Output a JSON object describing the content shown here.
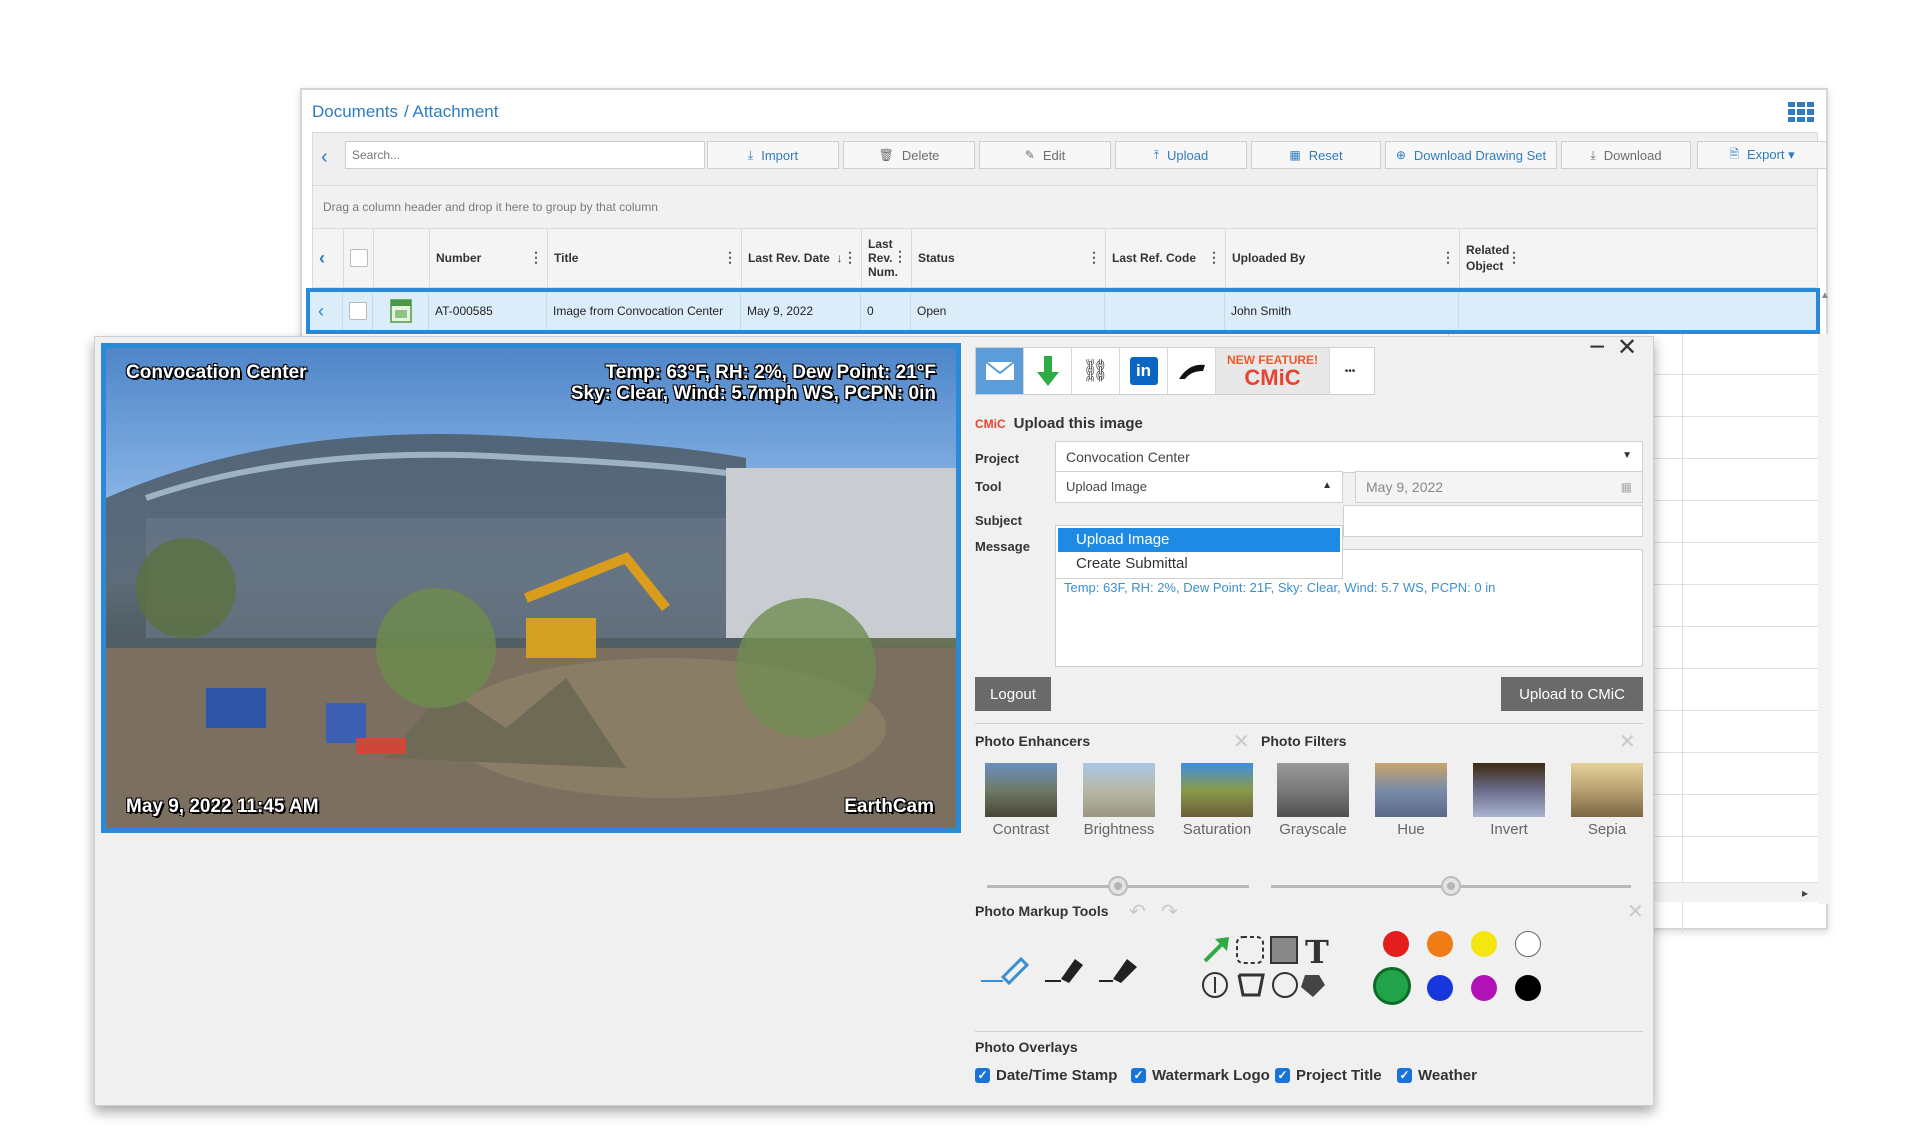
{
  "breadcrumb": {
    "root": "Documents",
    "current": "/ Attachment"
  },
  "toolbar": {
    "search_placeholder": "Search...",
    "buttons": [
      {
        "label": "Import",
        "icon": "download-icon"
      },
      {
        "label": "Delete",
        "icon": "trash-icon"
      },
      {
        "label": "Edit",
        "icon": "edit-icon"
      },
      {
        "label": "Upload",
        "icon": "upload-icon"
      },
      {
        "label": "Reset",
        "icon": "table-icon"
      },
      {
        "label": "Download Drawing Set",
        "icon": "plus-circle-icon"
      },
      {
        "label": "Download",
        "icon": "download-icon"
      },
      {
        "label": "Export ▾",
        "icon": "file-icon"
      }
    ]
  },
  "group_hint": "Drag a column header and drop it here to group by that column",
  "table": {
    "columns": [
      "Number",
      "Title",
      "Last Rev. Date",
      "Last Rev. Num.",
      "Status",
      "Last Ref. Code",
      "Uploaded By",
      "Related Object"
    ],
    "last_rev_num_lines": [
      "Last",
      "Rev.",
      "Num."
    ],
    "related_object_lines": [
      "Related",
      "Object"
    ],
    "sort_indicator": "↓",
    "row": {
      "number": "AT-000585",
      "title": "Image from Convocation Center",
      "last_rev_date": "May 9, 2022",
      "last_rev_num": "0",
      "status": "Open",
      "last_ref_code": "",
      "uploaded_by": "John Smith",
      "related_object": ""
    }
  },
  "photo": {
    "title": "Convocation Center",
    "weather_line1": "Temp: 63°F, RH: 2%, Dew Point: 21°F",
    "weather_line2": "Sky: Clear, Wind: 5.7mph WS, PCPN: 0in",
    "timestamp": "May 9, 2022 11:45 AM",
    "watermark": "EarthCam"
  },
  "window_controls": {
    "minimize": "−",
    "close": "✕"
  },
  "share": {
    "new_feature": "NEW FEATURE!",
    "cmic": "CMiC",
    "more": "•••"
  },
  "upload": {
    "badge": "CMiC",
    "heading": "Upload this image",
    "labels": {
      "project": "Project",
      "tool": "Tool",
      "subject": "Subject",
      "message": "Message"
    },
    "project_value": "Convocation Center",
    "tool_value": "Upload Image",
    "date_value": "May 9, 2022",
    "tool_options": [
      "Upload Image",
      "Create Submittal"
    ],
    "message_text": "Temp: 63F, RH: 2%, Dew Point: 21F, Sky: Clear, Wind: 5.7 WS, PCPN: 0 in",
    "logout": "Logout",
    "submit": "Upload to CMiC"
  },
  "enhancers": {
    "title": "Photo Enhancers",
    "items": [
      "Contrast",
      "Brightness",
      "Saturation"
    ],
    "slider_value": 0.5
  },
  "filters": {
    "title": "Photo Filters",
    "items": [
      "Grayscale",
      "Hue",
      "Invert",
      "Sepia"
    ],
    "slider_value": 0.5
  },
  "markup": {
    "title": "Photo Markup Tools",
    "colors_row1": [
      "#e41d1d",
      "#f07d14",
      "#f5e60f",
      "#ffffff"
    ],
    "colors_row2": [
      "#21a34a",
      "#1636e0",
      "#b012b8",
      "#000000"
    ],
    "selected_color": "#21a34a",
    "text_tool": "T"
  },
  "overlays": {
    "title": "Photo Overlays",
    "items": [
      "Date/Time Stamp",
      "Watermark Logo",
      "Project Title",
      "Weather"
    ]
  }
}
